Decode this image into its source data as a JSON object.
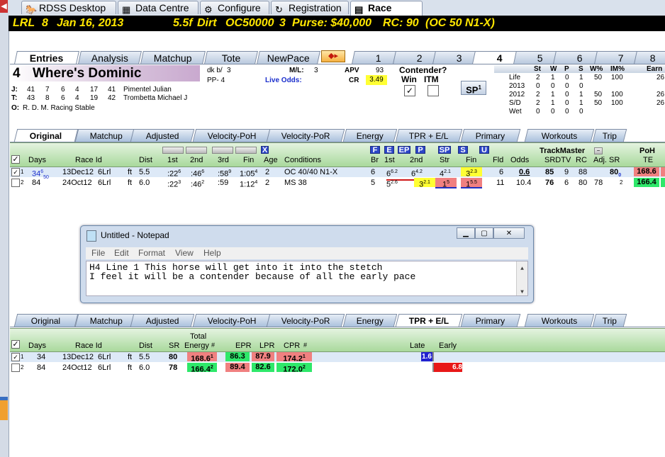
{
  "top_tabs": [
    {
      "label": "RDSS Desktop",
      "icon": "horse-icon"
    },
    {
      "label": "Data Centre",
      "icon": "calculator-icon"
    },
    {
      "label": "Configure",
      "icon": "gear-icon"
    },
    {
      "label": "Registration",
      "icon": "registration-icon"
    },
    {
      "label": "Race Cards",
      "icon": "race-cards-icon"
    }
  ],
  "race_header": {
    "track": "LRL",
    "race": "8",
    "date": "Jan 16, 2013",
    "distance": "5.5f",
    "surface": "Dirt",
    "class": "OC50000",
    "entries": "3",
    "purse": "Purse: $40,000",
    "rc": "RC: 90",
    "conditions": "(OC 50 N1-X)"
  },
  "panel_tabs": [
    "Entries",
    "Analysis",
    "Matchup",
    "Tote",
    "NewPace"
  ],
  "horse_tabs": [
    "1",
    "2",
    "3",
    "4",
    "5",
    "6",
    "7",
    "8"
  ],
  "horse": {
    "program": "4",
    "name": "Where's Dominic",
    "color": "dk b/",
    "age": "3",
    "pp": "PP- 4",
    "ml_label": "M/L:",
    "ml": "3",
    "live_odds_label": "Live Odds:",
    "apv_label": "APV",
    "apv": "93",
    "cr_label": "CR",
    "cr": "3.49",
    "jockey_label": "J:",
    "jockey_stats": [
      "41",
      "7",
      "6",
      "4",
      "17",
      "41"
    ],
    "jockey": "Pimentel Julian",
    "trainer_label": "T:",
    "trainer_stats": [
      "43",
      "8",
      "6",
      "4",
      "19",
      "42"
    ],
    "trainer": "Trombetta Michael J",
    "owner_label": "O:",
    "owner": "R. D. M. Racing Stable"
  },
  "contender": {
    "title": "Contender?",
    "win": "Win",
    "itm": "ITM",
    "sp": "SP",
    "sp_sup": "1"
  },
  "record": {
    "headers": [
      "St",
      "W",
      "P",
      "S",
      "W%",
      "IM%",
      "Earn"
    ],
    "rows": [
      {
        "label": "Life",
        "vals": [
          "2",
          "1",
          "0",
          "1",
          "50",
          "100",
          "26"
        ]
      },
      {
        "label": "2013",
        "vals": [
          "0",
          "0",
          "0",
          "0",
          "",
          "",
          ""
        ]
      },
      {
        "label": "2012",
        "vals": [
          "2",
          "1",
          "0",
          "1",
          "50",
          "100",
          "26"
        ]
      },
      {
        "label": "S/D",
        "vals": [
          "2",
          "1",
          "0",
          "1",
          "50",
          "100",
          "26"
        ]
      },
      {
        "label": "Wet",
        "vals": [
          "0",
          "0",
          "0",
          "0",
          "",
          "",
          ""
        ]
      }
    ]
  },
  "section_tabs": [
    "Original",
    "Matchup",
    "Adjusted",
    "Velocity-PoH",
    "Velocity-PoR",
    "Energy",
    "TPR + E/L",
    "Primary",
    "Workouts",
    "Trip"
  ],
  "pp_header": {
    "days": "Days",
    "race_id": "Race Id",
    "dist": "Dist",
    "c1": "1st",
    "c2": "2nd",
    "c3": "3rd",
    "fin": "Fin",
    "age": "Age",
    "cond": "Conditions",
    "br": "Br",
    "c1b": "1st",
    "c2b": "2nd",
    "str": "Str",
    "finb": "Fin",
    "fld": "Fld",
    "odds": "Odds",
    "trackmaster": "TrackMaster",
    "srdtv": "SRDTV",
    "rc": "RC",
    "adjsr": "Adj. SR",
    "poh": "PoH",
    "te": "TE",
    "btns": [
      "F",
      "E",
      "EP",
      "P",
      "SP",
      "S",
      "U",
      "X"
    ]
  },
  "pp_rows": [
    {
      "n": "1",
      "checked": "✓",
      "days": "34",
      "days_sup": "6",
      "days_sub": "50",
      "date": "13Dec12",
      "track": "6Lrl",
      "surf": "ft",
      "dist": "5.5",
      "f1": ":22",
      "f1s": "6",
      "f2": ":46",
      "f2s": "6",
      "f3": ":58",
      "f3s": "9",
      "fin": "1:05",
      "fins": "4",
      "age": "2",
      "cond": "OC 40/40 N1-X",
      "br": "6",
      "p1": "6",
      "p1s": "6.2",
      "p2": "6",
      "p2s": "4.2",
      "str": "4",
      "strs": "2.1",
      "fn": "3",
      "fns": "2.3",
      "fld": "6",
      "odds": "0.6",
      "srdtv": "85",
      "tv": "9",
      "rc": "88",
      "adj": "80",
      "adjs": "0",
      "te": "168.6"
    },
    {
      "n": "2",
      "checked": "",
      "days": "84",
      "days_sup": "",
      "days_sub": "",
      "date": "24Oct12",
      "track": "6Lrl",
      "surf": "ft",
      "dist": "6.0",
      "f1": ":22",
      "f1s": "3",
      "f2": ":46",
      "f2s": "2",
      "f3": ":59",
      "f3s": "",
      "fin": "1:12",
      "fins": "4",
      "age": "2",
      "cond": "MS 38",
      "br": "5",
      "p1": "5",
      "p1s": "2.6",
      "p2": "3",
      "p2s": "2.1",
      "str": "1",
      "strs": "5",
      "fn": "1",
      "fns": "5.5",
      "fld": "11",
      "odds": "10.4",
      "srdtv": "76",
      "tv": "6",
      "rc": "80",
      "adj": "78",
      "adjs": "2",
      "te": "166.4"
    }
  ],
  "notepad": {
    "title": "Untitled - Notepad",
    "menu": [
      "File",
      "Edit",
      "Format",
      "View",
      "Help"
    ],
    "line1": "H4 Line 1 This horse will get into it into the stetch",
    "line2": "I feel it will be a contender because of all the early pace"
  },
  "tpr_header": {
    "days": "Days",
    "race_id": "Race Id",
    "dist": "Dist",
    "sr": "SR",
    "total": "Total",
    "energy": "Energy",
    "epr": "EPR",
    "lpr": "LPR",
    "cpr": "CPR",
    "hash": "#",
    "late": "Late",
    "early": "Early"
  },
  "tpr_rows": [
    {
      "n": "1",
      "checked": "✓",
      "days": "34",
      "date": "13Dec12",
      "track": "6Lrl",
      "surf": "ft",
      "dist": "5.5",
      "sr": "80",
      "energy": "168.6",
      "energy_n": "1",
      "epr": "86.3",
      "lpr": "87.9",
      "cpr": "174.2",
      "cpr_n": "1",
      "late": "1.6",
      "early": ""
    },
    {
      "n": "2",
      "checked": "",
      "days": "84",
      "date": "24Oct12",
      "track": "6Lrl",
      "surf": "ft",
      "dist": "6.0",
      "sr": "78",
      "energy": "166.4",
      "energy_n": "2",
      "epr": "89.4",
      "lpr": "82.6",
      "cpr": "172.0",
      "cpr_n": "2",
      "late": "",
      "early": "6.8"
    }
  ],
  "colors": {
    "header_bar": "#000000",
    "header_text": "#ffe600",
    "green_head": "#a9d99c",
    "red_cell": "#f08080",
    "green_cell": "#2ee86a",
    "yellow_cell": "#ffff33"
  }
}
